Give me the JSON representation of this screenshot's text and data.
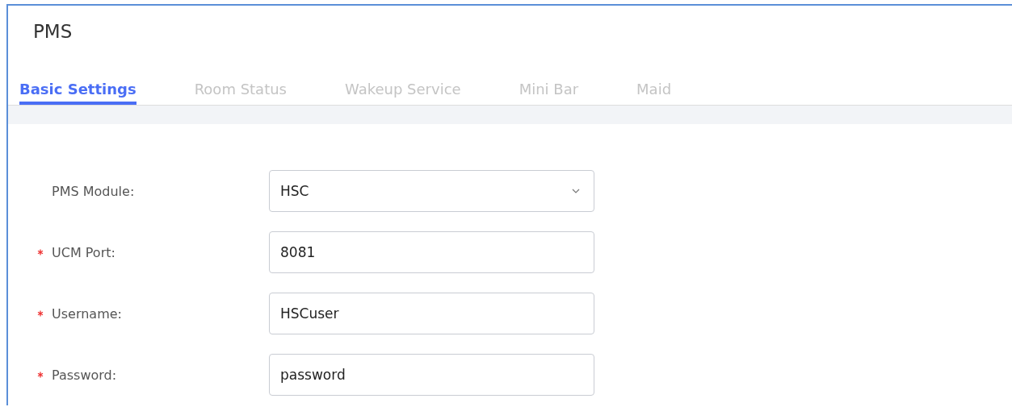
{
  "page": {
    "title": "PMS"
  },
  "tabs": [
    {
      "label": "Basic Settings",
      "selected": true
    },
    {
      "label": "Room Status",
      "selected": false
    },
    {
      "label": "Wakeup Service",
      "selected": false
    },
    {
      "label": "Mini Bar",
      "selected": false
    },
    {
      "label": "Maid",
      "selected": false
    }
  ],
  "form": [
    {
      "label": "PMS Module:",
      "required": false,
      "kind": "select",
      "value": "HSC"
    },
    {
      "label": "UCM Port:",
      "required": true,
      "kind": "text",
      "value": "8081"
    },
    {
      "label": "Username:",
      "required": true,
      "kind": "text",
      "value": "HSCuser"
    },
    {
      "label": "Password:",
      "required": true,
      "kind": "text",
      "value": "password"
    }
  ]
}
